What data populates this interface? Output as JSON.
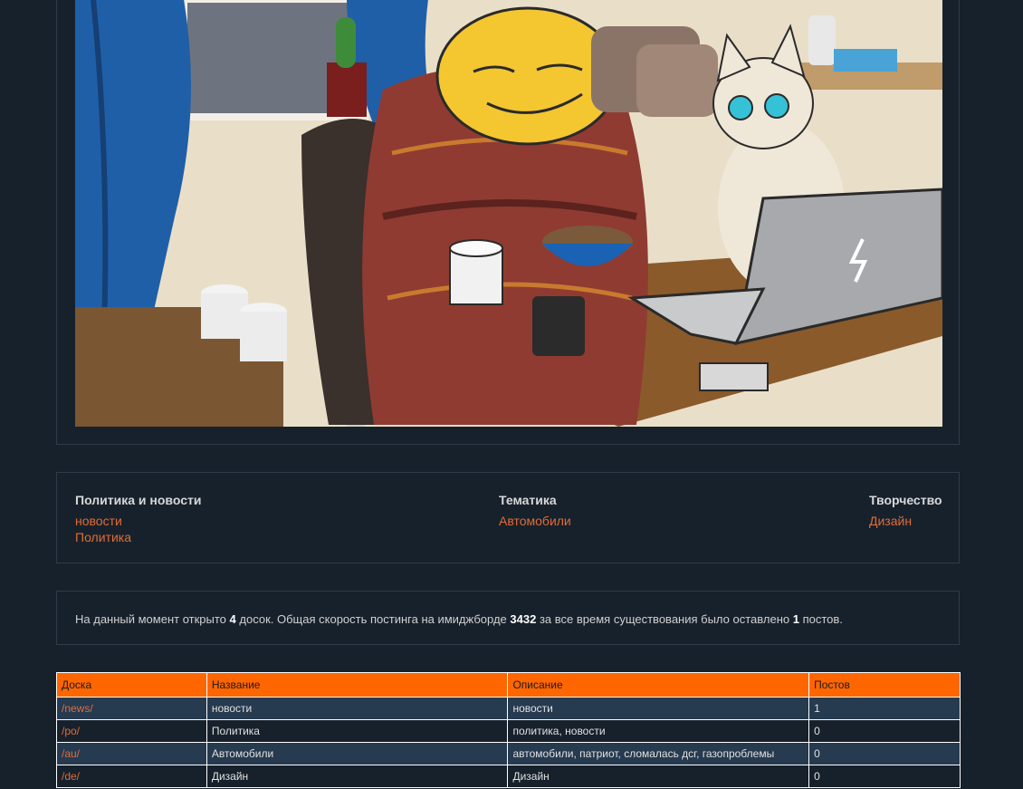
{
  "categories": [
    {
      "title": "Политика и новости",
      "links": [
        "новости",
        "Политика"
      ]
    },
    {
      "title": "Тематика",
      "links": [
        "Автомобили"
      ]
    },
    {
      "title": "Творчество",
      "links": [
        "Дизайн"
      ]
    }
  ],
  "stats": {
    "prefix": "На данный момент открыто",
    "boards_count": "4",
    "middle": "досок. Общая скорость постинга на имиджборде",
    "speed": "3432",
    "suffix": "за все время существования было оставлено",
    "posts_total": "1",
    "end": "постов."
  },
  "table": {
    "headers": [
      "Доска",
      "Название",
      "Описание",
      "Постов"
    ],
    "rows": [
      {
        "board": "/news/",
        "name": "новости",
        "description": "новости",
        "posts": "1"
      },
      {
        "board": "/po/",
        "name": "Политика",
        "description": "политика, новости",
        "posts": "0"
      },
      {
        "board": "/au/",
        "name": "Автомобили",
        "description": "автомобили, патриот, сломалась дсг, газопроблемы",
        "posts": "0"
      },
      {
        "board": "/de/",
        "name": "Дизайн",
        "description": "Дизайн",
        "posts": "0"
      }
    ]
  },
  "colors": {
    "background": "#17212b",
    "accent": "#ff6600",
    "link": "#e06c37",
    "row_alt": "#263a50"
  }
}
